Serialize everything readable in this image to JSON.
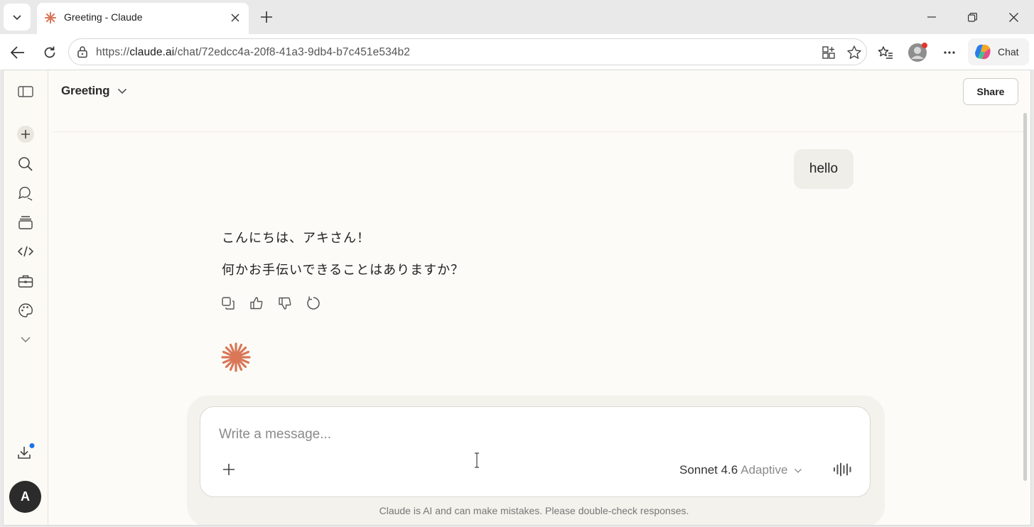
{
  "browser": {
    "tab_title": "Greeting - Claude",
    "url_scheme": "https://",
    "url_host": "claude.ai",
    "url_path": "/chat/72edcc4a-20f8-41a3-9db4-b7c451e534b2",
    "chat_button_label": "Chat"
  },
  "header": {
    "conversation_title": "Greeting",
    "share_label": "Share"
  },
  "sidebar": {
    "avatar_initial": "A",
    "icons": [
      "sidebar-toggle-icon",
      "new-chat-icon",
      "search-icon",
      "chats-icon",
      "projects-icon",
      "code-icon",
      "tools-icon",
      "artifacts-icon",
      "more-chevron-icon",
      "download-icon"
    ]
  },
  "messages": {
    "user": "hello",
    "assistant_lines": [
      "こんにちは、アキさん！",
      "何かお手伝いできることはありますか？"
    ]
  },
  "composer": {
    "placeholder": "Write a message...",
    "model_name": "Sonnet 4.6",
    "model_mode": "Adaptive"
  },
  "footer": {
    "disclaimer": "Claude is AI and can make mistakes. Please double-check responses."
  },
  "colors": {
    "accent": "#d97757",
    "page_bg": "#fcfbf7",
    "avatar_bg": "#2b2b2b",
    "notification_dot": "#1a73e8"
  }
}
